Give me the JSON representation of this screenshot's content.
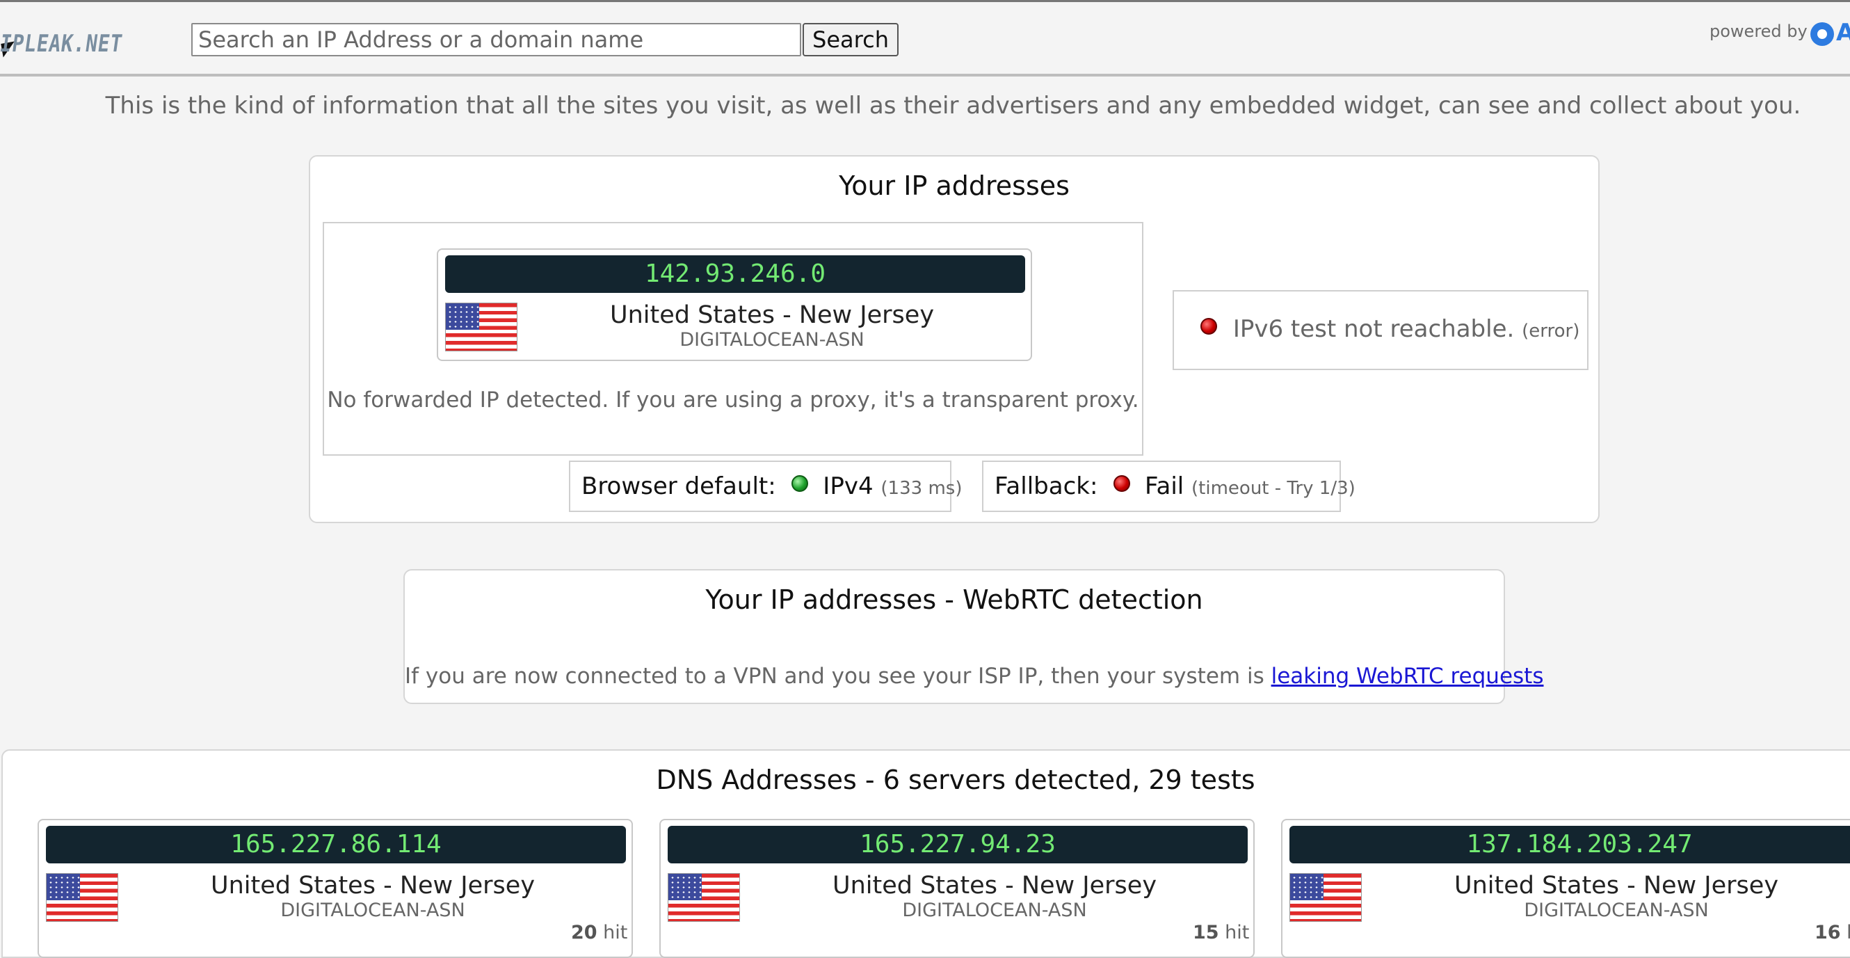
{
  "header": {
    "logo_text": "IPLEAK.NET",
    "search_placeholder": "Search an IP Address or a domain name",
    "search_label": "Search",
    "powered_by": "powered by",
    "brand_letter": "A"
  },
  "intro": "This is the kind of information that all the sites you visit, as well as their advertisers and any embedded widget, can see and collect about you.",
  "ip_panel": {
    "title": "Your IP addresses",
    "card": {
      "ip": "142.93.246.0",
      "location": "United States - New Jersey",
      "isp": "DIGITALOCEAN-ASN"
    },
    "forwarded_note": "No forwarded IP detected. If you are using a proxy, it's a transparent proxy.",
    "ipv6": {
      "label": "IPv6 test not reachable.",
      "status": "(error)"
    },
    "browser_default": {
      "label": "Browser default:",
      "protocol": "IPv4",
      "timing": "(133 ms)"
    },
    "fallback": {
      "label": "Fallback:",
      "result": "Fail",
      "detail": "(timeout - Try 1/3)"
    }
  },
  "webrtc_panel": {
    "title": "Your IP addresses - WebRTC detection",
    "description": "If you are now connected to a VPN and you see your ISP IP, then your system is",
    "link_text": "leaking WebRTC requests"
  },
  "dns_panel": {
    "title": "DNS Addresses - 6 servers detected, 29 tests",
    "servers": [
      {
        "ip": "165.227.86.114",
        "location": "United States - New Jersey",
        "isp": "DIGITALOCEAN-ASN",
        "hits": "20",
        "hit_label": "hit"
      },
      {
        "ip": "165.227.94.23",
        "location": "United States - New Jersey",
        "isp": "DIGITALOCEAN-ASN",
        "hits": "15",
        "hit_label": "hit"
      },
      {
        "ip": "137.184.203.247",
        "location": "United States - New Jersey",
        "isp": "DIGITALOCEAN-ASN",
        "hits": "16",
        "hit_label": "h"
      }
    ]
  }
}
